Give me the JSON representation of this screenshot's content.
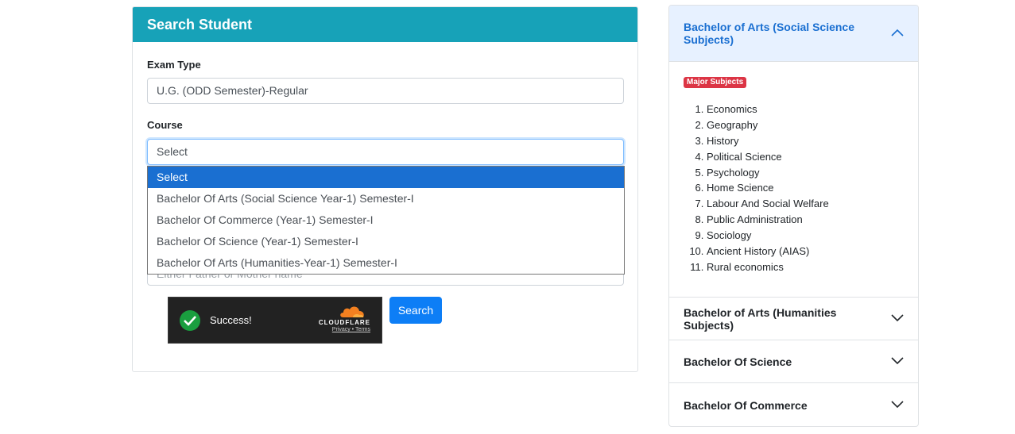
{
  "search_card": {
    "title": "Search Student",
    "exam_type_label": "Exam Type",
    "exam_type_value": "U.G. (ODD Semester)-Regular",
    "course_label": "Course",
    "course_value": "Select",
    "course_options": [
      "Select",
      "Bachelor Of Arts (Social Science Year-1) Semester-I",
      "Bachelor Of Commerce (Year-1) Semester-I",
      "Bachelor Of Science (Year-1) Semester-I",
      "Bachelor Of Arts (Humanities-Year-1) Semester-I"
    ],
    "parent_name_placeholder": "Either Father or Mother name",
    "captcha_status": "Success!",
    "captcha_brand": "CLOUDFLARE",
    "captcha_links": "Privacy • Terms",
    "search_button": "Search"
  },
  "accordion": {
    "sections": [
      {
        "title": "Bachelor of Arts (Social Science Subjects)",
        "expanded": true
      },
      {
        "title": "Bachelor of Arts (Humanities Subjects)",
        "expanded": false
      },
      {
        "title": "Bachelor Of Science",
        "expanded": false
      },
      {
        "title": "Bachelor Of Commerce",
        "expanded": false
      }
    ],
    "badge": "Major Subjects",
    "subjects": [
      "Economics",
      "Geography",
      "History",
      "Political Science",
      "Psychology",
      "Home Science",
      "Labour And Social Welfare",
      "Public Administration",
      "Sociology",
      "Ancient History (AIAS)",
      "Rural economics"
    ]
  },
  "colors": {
    "header": "#17a2b8",
    "primary": "#0d7ef6",
    "selected_option": "#1a6fd1",
    "badge": "#dc3545",
    "accordion_active_bg": "#e7f1ff"
  }
}
